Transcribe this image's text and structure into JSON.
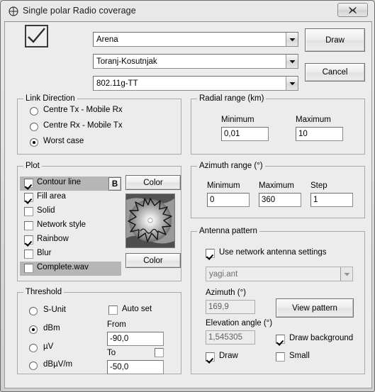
{
  "window": {
    "title": "Single polar Radio coverage",
    "icon": "target-crosshair-icon",
    "close_label": "×"
  },
  "top": {
    "confirm_icon": "checkmark-icon",
    "fields": [
      {
        "label": "Centre unit",
        "value": "Arena"
      },
      {
        "label": "Mobile unit",
        "value": "Toranj-Kosutnjak"
      },
      {
        "label": "Network",
        "value": "802.11g-TT"
      }
    ],
    "buttons": {
      "draw": "Draw",
      "cancel": "Cancel"
    }
  },
  "link_direction": {
    "title": "Link Direction",
    "options": [
      {
        "label": "Centre Tx - Mobile Rx",
        "selected": false
      },
      {
        "label": "Centre Rx - Mobile Tx",
        "selected": false
      },
      {
        "label": "Worst case",
        "selected": true
      }
    ]
  },
  "radial_range": {
    "title": "Radial range (km)",
    "minimum_label": "Minimum",
    "minimum_value": "0,01",
    "maximum_label": "Maximum",
    "maximum_value": "10"
  },
  "plot": {
    "title": "Plot",
    "items": [
      {
        "label": "Contour line",
        "checked": true,
        "highlighted": true
      },
      {
        "label": "Fill area",
        "checked": true,
        "highlighted": false
      },
      {
        "label": "Solid",
        "checked": false,
        "highlighted": false
      },
      {
        "label": "Network style",
        "checked": false,
        "highlighted": false
      },
      {
        "label": "Rainbow",
        "checked": true,
        "highlighted": false
      },
      {
        "label": "Blur",
        "checked": false,
        "highlighted": false
      },
      {
        "label": "Complete.wav",
        "checked": false,
        "highlighted": true
      }
    ],
    "b_button": "B",
    "color_button_top": "Color",
    "color_button_bottom": "Color",
    "preview_icon": "polar-coverage-preview"
  },
  "azimuth_range": {
    "title": "Azimuth range (°)",
    "minimum_label": "Minimum",
    "minimum_value": "0",
    "maximum_label": "Maximum",
    "maximum_value": "360",
    "step_label": "Step",
    "step_value": "1"
  },
  "antenna_pattern": {
    "title": "Antenna pattern",
    "use_network_label": "Use network antenna settings",
    "use_network_checked": true,
    "file_value": "yagi.ant",
    "azimuth_label": "Azimuth (°)",
    "azimuth_value": "169,9",
    "elevation_label": "Elevation angle (°)",
    "elevation_value": "1,545305",
    "view_pattern_button": "View pattern",
    "draw_background_label": "Draw background",
    "draw_background_checked": true,
    "draw_label": "Draw",
    "draw_checked": true,
    "small_label": "Small",
    "small_checked": false
  },
  "threshold": {
    "title": "Threshold",
    "units": [
      {
        "label": "S-Unit",
        "selected": false
      },
      {
        "label": "dBm",
        "selected": true
      },
      {
        "label": "µV",
        "selected": false
      },
      {
        "label": "dBµV/m",
        "selected": false
      }
    ],
    "auto_set_label": "Auto set",
    "auto_set_checked": false,
    "from_label": "From",
    "from_value": "-90,0",
    "to_label": "To",
    "to_value": "-50,0",
    "to_checked": false
  }
}
